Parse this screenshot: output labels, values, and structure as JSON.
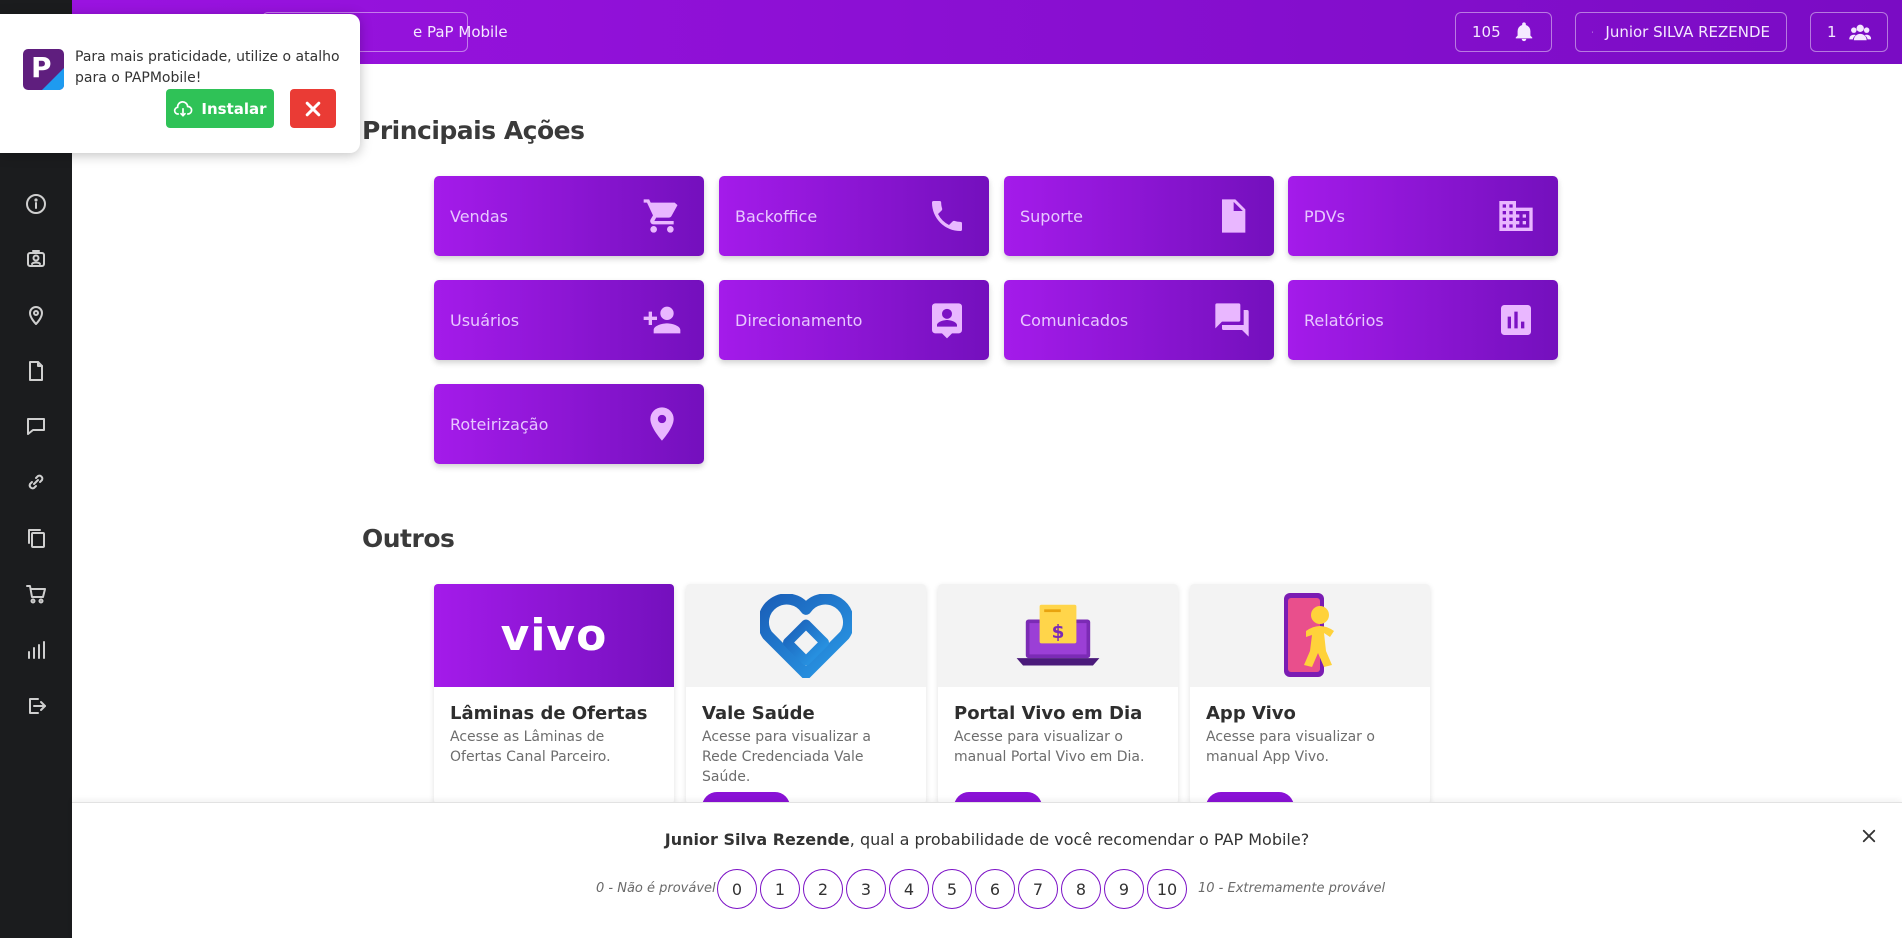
{
  "topbar": {
    "link_label": "e PaP Mobile",
    "notifications_count": "105",
    "user_name": "Junior SILVA REZENDE",
    "groups_count": "1"
  },
  "install_banner": {
    "message": "Para mais praticidade, utilize o atalho para o PAPMobile!",
    "install_label": "Instalar",
    "logo_letter": "P"
  },
  "sidebar": {
    "icons": [
      "info-icon",
      "profile-card-icon",
      "location-icon",
      "document-icon",
      "chat-icon",
      "link-icon",
      "copy-icon",
      "cart-icon",
      "bar-chart-icon",
      "logout-icon"
    ]
  },
  "main": {
    "principais_title": "Principais Ações",
    "actions": [
      {
        "label": "Vendas",
        "icon": "cart-icon"
      },
      {
        "label": "Backoffice",
        "icon": "phone-icon"
      },
      {
        "label": "Suporte",
        "icon": "file-icon"
      },
      {
        "label": "PDVs",
        "icon": "building-icon"
      },
      {
        "label": "Usuários",
        "icon": "add-user-icon"
      },
      {
        "label": "Direcionamento",
        "icon": "contact-icon"
      },
      {
        "label": "Comunicados",
        "icon": "messages-icon"
      },
      {
        "label": "Relatórios",
        "icon": "report-icon"
      },
      {
        "label": "Roteirização",
        "icon": "pin-icon"
      }
    ],
    "outros_title": "Outros",
    "cards": [
      {
        "title": "Lâminas de Ofertas",
        "desc": "Acesse as Lâminas de Ofertas Canal Parceiro.",
        "logo_text": "vivo"
      },
      {
        "title": "Vale Saúde",
        "desc": "Acesse para visualizar a Rede Credenciada Vale Saúde."
      },
      {
        "title": "Portal Vivo em Dia",
        "desc": "Acesse para visualizar o manual Portal Vivo em Dia."
      },
      {
        "title": "App Vivo",
        "desc": "Acesse para visualizar o manual App Vivo."
      }
    ]
  },
  "nps": {
    "name": "Junior Silva Rezende",
    "question": ", qual a probabilidade de você recomendar o PAP Mobile?",
    "low_label": "0 - Não é provável",
    "high_label": "10 - Extremamente provável",
    "scale": [
      "0",
      "1",
      "2",
      "3",
      "4",
      "5",
      "6",
      "7",
      "8",
      "9",
      "10"
    ]
  },
  "colors": {
    "brand": "#8a12d6",
    "sidebar": "#1b1c1e",
    "install_green": "#2fc257",
    "close_red": "#ea3b35"
  }
}
